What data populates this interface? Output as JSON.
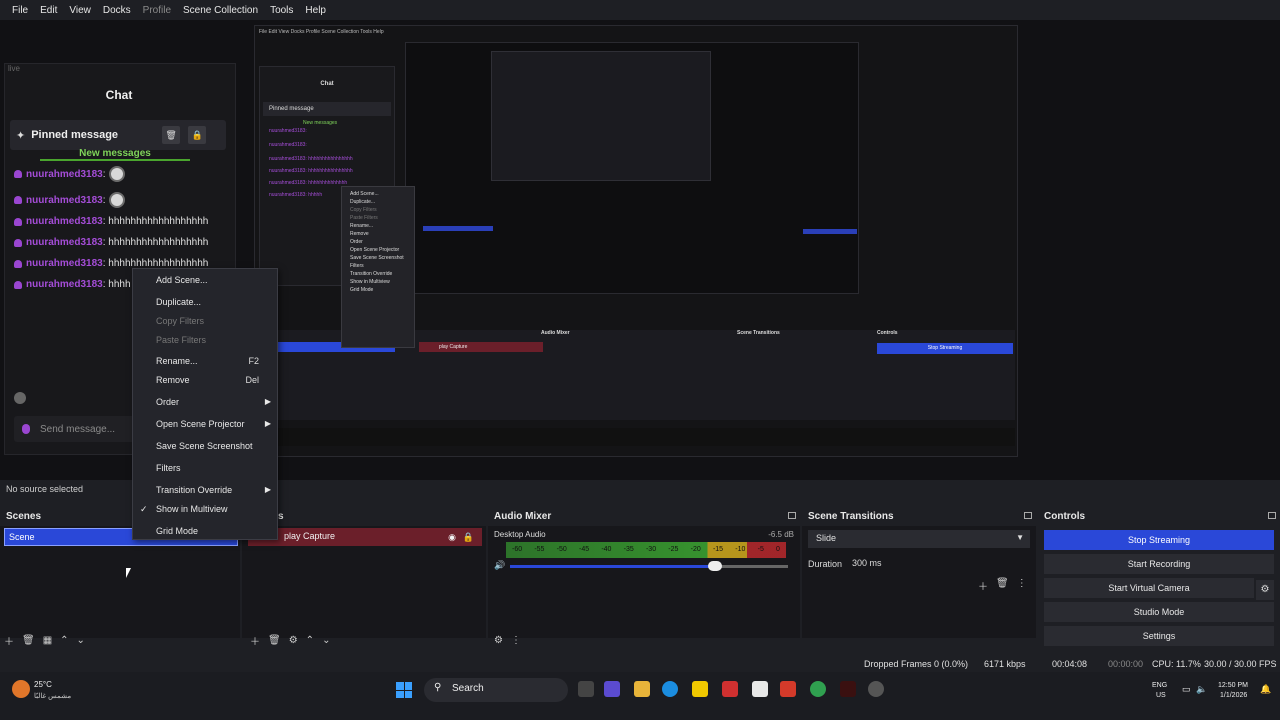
{
  "menubar": {
    "items": [
      "File",
      "Edit",
      "View",
      "Docks",
      "Profile",
      "Scene Collection",
      "Tools",
      "Help"
    ]
  },
  "preview": {
    "chat": {
      "search": "live",
      "title": "Chat",
      "pinned": "Pinned message",
      "new_messages": "New messages",
      "lines": [
        {
          "user": "nuurahmed3183",
          "text": ":"
        },
        {
          "user": "nuurahmed3183",
          "text": ":"
        },
        {
          "user": "nuurahmed3183",
          "text": ": hhhhhhhhhhhhhhhhhh"
        },
        {
          "user": "nuurahmed3183",
          "text": ": hhhhhhhhhhhhhhhhhh"
        },
        {
          "user": "nuurahmed3183",
          "text": ": hhhhhhhhhhhhhhhhhh"
        },
        {
          "user": "nuurahmed3183",
          "text": ": hhhh"
        }
      ],
      "send_placeholder": "Send message..."
    },
    "nested": {
      "menubar": "File  Edit  View  Docks  Profile  Scene Collection  Tools  Help",
      "chat_title": "Chat",
      "pinned": "Pinned message",
      "new_messages": "New messages",
      "lines": [
        "nuurahmed3183:",
        "nuurahmed3183:",
        "nuurahmed3183: hhhhhhhhhhhhhhhh",
        "nuurahmed3183: hhhhhhhhhhhhhhhh",
        "nuurahmed3183: hhhhhhhhhhhhhh",
        "nuurahmed3183: hhhhh"
      ],
      "menu": [
        "Add Scene...",
        "Duplicate...",
        "Copy Filters",
        "Paste Filters",
        "Rename...",
        "Remove",
        "Order",
        "Open Scene Projector",
        "Save Scene Screenshot",
        "Filters",
        "Transition Override",
        "Show in Multiview",
        "Grid Mode"
      ],
      "source": "play Capture",
      "audio_mixer": "Audio Mixer",
      "scene_transitions": "Scene Transitions",
      "controls": "Controls",
      "stop_streaming": "Stop Streaming"
    }
  },
  "status": {
    "no_source": "No source selected"
  },
  "docks": {
    "scenes": {
      "title": "Scenes",
      "items": [
        "Scene"
      ]
    },
    "sources": {
      "title_visible": "s",
      "items": [
        {
          "name": "play Capture"
        }
      ]
    },
    "audio_mixer": {
      "title": "Audio Mixer",
      "source": "Desktop Audio",
      "db": "-6.5 dB",
      "ticks": [
        "-60",
        "-55",
        "-50",
        "-45",
        "-40",
        "-35",
        "-30",
        "-25",
        "-20",
        "-15",
        "-10",
        "-5",
        "0"
      ],
      "level": 0.72
    },
    "scene_transitions": {
      "title": "Scene Transitions",
      "transition": "Slide",
      "duration_label": "Duration",
      "duration_value": "300 ms"
    },
    "controls": {
      "title": "Controls",
      "buttons": [
        "Stop Streaming",
        "Start Recording",
        "Start Virtual Camera",
        "Studio Mode",
        "Settings"
      ]
    }
  },
  "context_menu": {
    "items": [
      {
        "label": "Add Scene...",
        "enabled": true
      },
      {
        "label": "Duplicate...",
        "enabled": true
      },
      {
        "label": "Copy Filters",
        "enabled": false
      },
      {
        "label": "Paste Filters",
        "enabled": false
      },
      {
        "label": "Rename...",
        "shortcut": "F2",
        "enabled": true
      },
      {
        "label": "Remove",
        "shortcut": "Del",
        "enabled": true
      },
      {
        "label": "Order",
        "submenu": true,
        "enabled": true
      },
      {
        "label": "Open Scene Projector",
        "submenu": true,
        "enabled": true
      },
      {
        "label": "Save Scene Screenshot",
        "enabled": true
      },
      {
        "label": "Filters",
        "enabled": true
      },
      {
        "label": "Transition Override",
        "submenu": true,
        "enabled": true
      },
      {
        "label": "Show in Multiview",
        "checked": true,
        "enabled": true
      },
      {
        "label": "Grid Mode",
        "enabled": true
      }
    ]
  },
  "statusbar": {
    "dropped": "Dropped Frames 0 (0.0%)",
    "bitrate": "6171 kbps",
    "stream_time": "00:04:08",
    "rec_time": "00:00:00",
    "cpu": "CPU: 11.7%",
    "fps": "30.00 / 30.00 FPS"
  },
  "taskbar": {
    "weather_temp": "25°C",
    "weather_desc": "مشمس غالبًا",
    "search": "Search",
    "lang1": "ENG",
    "lang2": "US",
    "time": "12:50 PM",
    "date": "1/1/2026"
  },
  "colors": {
    "accent": "#2a48d8",
    "source_red": "#6b1f2a",
    "chat_user": "#a54dd8"
  }
}
